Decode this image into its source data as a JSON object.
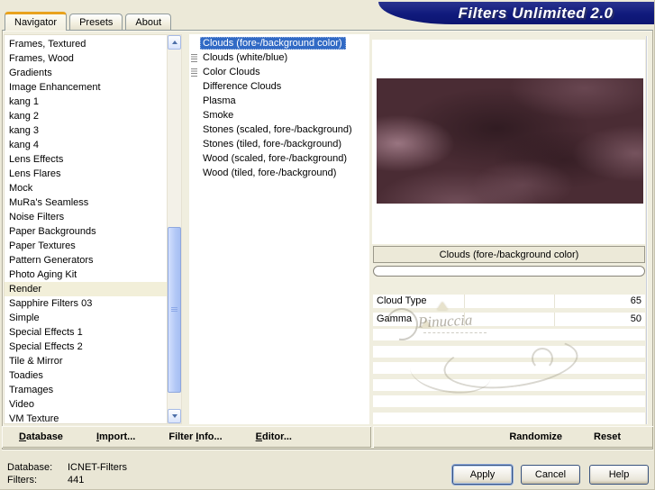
{
  "window": {
    "app_title": "Filters Unlimited 2.0"
  },
  "tabs": [
    {
      "label": "Navigator",
      "active": true
    },
    {
      "label": "Presets",
      "active": false
    },
    {
      "label": "About",
      "active": false
    }
  ],
  "categories": {
    "items": [
      {
        "label": "Frames, Textured"
      },
      {
        "label": "Frames, Wood"
      },
      {
        "label": "Gradients"
      },
      {
        "label": "Image Enhancement"
      },
      {
        "label": "kang 1"
      },
      {
        "label": "kang 2"
      },
      {
        "label": "kang 3"
      },
      {
        "label": "kang 4"
      },
      {
        "label": "Lens Effects"
      },
      {
        "label": "Lens Flares"
      },
      {
        "label": "Mock"
      },
      {
        "label": "MuRa's Seamless"
      },
      {
        "label": "Noise Filters"
      },
      {
        "label": "Paper Backgrounds"
      },
      {
        "label": "Paper Textures"
      },
      {
        "label": "Pattern Generators"
      },
      {
        "label": "Photo Aging Kit"
      },
      {
        "label": "Render",
        "selected": true
      },
      {
        "label": "Sapphire Filters 03"
      },
      {
        "label": "Simple"
      },
      {
        "label": "Special Effects 1"
      },
      {
        "label": "Special Effects 2"
      },
      {
        "label": "Tile & Mirror"
      },
      {
        "label": "Toadies"
      },
      {
        "label": "Tramages"
      },
      {
        "label": "Video"
      },
      {
        "label": "VM Texture"
      }
    ]
  },
  "filters": {
    "items": [
      {
        "label": "Clouds (fore-/background color)",
        "selected": true
      },
      {
        "label": "Clouds (white/blue)",
        "marker": true
      },
      {
        "label": "Color Clouds",
        "marker": true
      },
      {
        "label": "Difference Clouds"
      },
      {
        "label": "Plasma"
      },
      {
        "label": "Smoke"
      },
      {
        "label": "Stones (scaled, fore-/background)"
      },
      {
        "label": "Stones (tiled, fore-/background)"
      },
      {
        "label": "Wood (scaled, fore-/background)"
      },
      {
        "label": "Wood (tiled, fore-/background)"
      }
    ]
  },
  "preview": {
    "selected_filter_label": "Clouds (fore-/background color)"
  },
  "parameters": {
    "items": [
      {
        "name": "Cloud Type",
        "value": "65",
        "thumb_pct": 25.5
      },
      {
        "name": "Gamma",
        "value": "50",
        "thumb_pct": 19.6
      }
    ]
  },
  "toolbar": {
    "left_buttons": [
      {
        "pre": "",
        "key": "D",
        "post": "atabase"
      },
      {
        "pre": "",
        "key": "I",
        "post": "mport..."
      },
      {
        "pre": "Filter ",
        "key": "I",
        "post": "nfo..."
      },
      {
        "pre": "",
        "key": "E",
        "post": "ditor..."
      }
    ],
    "randomize_label": "Randomize",
    "reset_label": "Reset"
  },
  "status": {
    "database_label": "Database:",
    "database_value": "ICNET-Filters",
    "filters_label": "Filters:",
    "filters_value": "441"
  },
  "footer_buttons": {
    "apply": "Apply",
    "cancel": "Cancel",
    "help": "Help"
  },
  "watermark": {
    "name": "Pinuccia"
  },
  "colors": {
    "dialog_beige": "#ECE9D8",
    "banner_navy": "#101A7C",
    "tab_accent_orange": "#E8A21D",
    "selection_blue": "#316AC5",
    "category_highlight": "#F2EFD9"
  }
}
